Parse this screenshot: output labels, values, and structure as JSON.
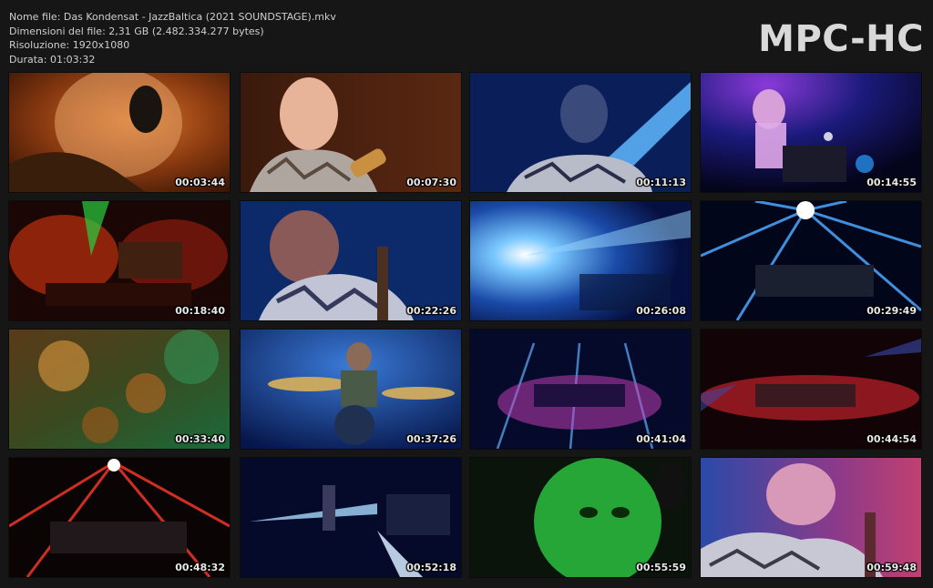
{
  "file_info": {
    "name_line": "Nome file: Das Kondensat - JazzBaltica (2021 SOUNDSTAGE).mkv",
    "size_line": "Dimensioni del file: 2,31 GB (2.482.334.277 bytes)",
    "resolution_line": "Risoluzione: 1920x1080",
    "duration_line": "Durata: 01:03:32"
  },
  "logo": "MPC-HC",
  "thumbnails": [
    {
      "time": "00:03:44",
      "scene": "drummer-headphones-orange"
    },
    {
      "time": "00:07:30",
      "scene": "saxophonist-closeup"
    },
    {
      "time": "00:11:13",
      "scene": "guitarist-blue-beam"
    },
    {
      "time": "00:14:55",
      "scene": "stage-blue-purple-lights"
    },
    {
      "time": "00:18:40",
      "scene": "stage-red-green"
    },
    {
      "time": "00:22:26",
      "scene": "guitarist-blue-closeup"
    },
    {
      "time": "00:26:08",
      "scene": "blue-flare"
    },
    {
      "time": "00:29:49",
      "scene": "light-rays-stage"
    },
    {
      "time": "00:33:40",
      "scene": "bokeh-green-orange"
    },
    {
      "time": "00:37:26",
      "scene": "drummer-cymbals"
    },
    {
      "time": "00:41:04",
      "scene": "stage-blue-magenta"
    },
    {
      "time": "00:44:54",
      "scene": "stage-red-wide"
    },
    {
      "time": "00:48:32",
      "scene": "red-rays-stage"
    },
    {
      "time": "00:52:18",
      "scene": "stage-blue-spotlight"
    },
    {
      "time": "00:55:59",
      "scene": "green-face-closeup"
    },
    {
      "time": "00:59:48",
      "scene": "guitarist-magenta"
    }
  ]
}
